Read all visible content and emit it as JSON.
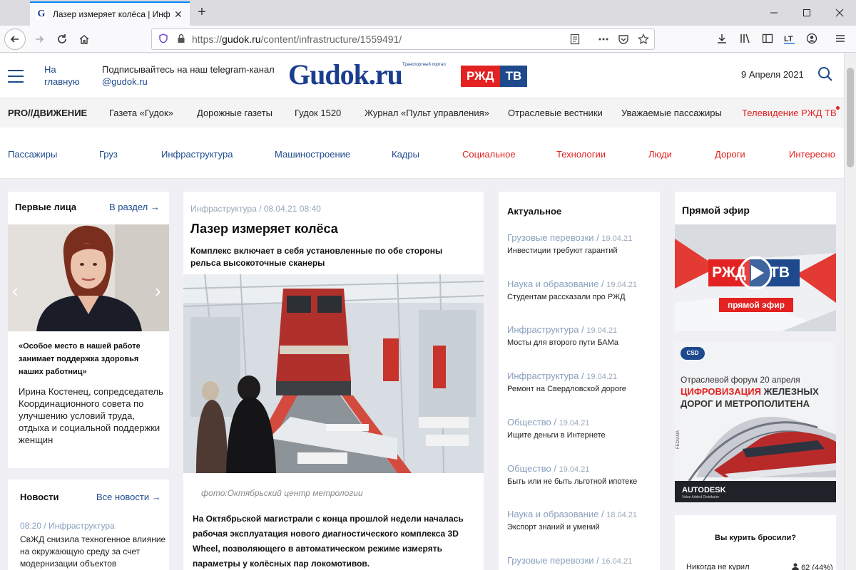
{
  "browser": {
    "tab_title": "Лазер измеряет колёса | Инфраструктура",
    "favicon_letter": "G",
    "tab_close": "✕",
    "new_tab": "+",
    "url_prefix": "https://",
    "url_host": "gudok.ru",
    "url_path": "/content/infrastructure/1559491/"
  },
  "header": {
    "home_link": "На главную",
    "telegram_text": "Подписывайтесь на наш telegram-канал",
    "telegram_handle": "@gudok.ru",
    "logo_text": "Gudok.ru",
    "logo_sub": "Транспортный портал",
    "rzd_left": "РЖД",
    "rzd_right": "ТВ",
    "date": "9 Апреля 2021"
  },
  "top_nav": [
    {
      "label": "PRO//ДВИЖЕНИЕ"
    },
    {
      "label": "Газета «Гудок»"
    },
    {
      "label": "Дорожные газеты"
    },
    {
      "label": "Гудок 1520"
    },
    {
      "label": "Журнал «Пульт управления»"
    },
    {
      "label": "Отраслевые вестники"
    },
    {
      "label": "Уважаемые пассажиры"
    },
    {
      "label": "Телевидение РЖД ТВ"
    }
  ],
  "categories": [
    {
      "label": "Пассажиры",
      "color": "#1e4a8d"
    },
    {
      "label": "Груз",
      "color": "#1e4a8d"
    },
    {
      "label": "Инфраструктура",
      "color": "#1e4a8d"
    },
    {
      "label": "Машиностроение",
      "color": "#1e4a8d"
    },
    {
      "label": "Кадры",
      "color": "#1e4a8d"
    },
    {
      "label": "Социальное",
      "color": "#e32221"
    },
    {
      "label": "Технологии",
      "color": "#e32221"
    },
    {
      "label": "Люди",
      "color": "#e32221"
    },
    {
      "label": "Дороги",
      "color": "#e32221"
    },
    {
      "label": "Интересно",
      "color": "#e32221"
    }
  ],
  "first_persons": {
    "heading": "Первые лица",
    "link": "В раздел →",
    "prev": "‹",
    "next": "›",
    "quote": "«Особое место в нашей работе занимает поддержка здоровья наших работниц»",
    "person": "Ирина Костенец, сопредседатель Координационного совета по улучшению условий труда, отдыха и социальной поддержки женщин"
  },
  "news": {
    "heading": "Новости",
    "link": "Все новости →",
    "meta": "08:20 / Инфраструктура",
    "text": "СвЖД снизила техногенное влияние на окружающую среду за счет модернизации объектов"
  },
  "article": {
    "meta": "Инфраструктура / 08.04.21 08:40",
    "title": "Лазер измеряет колёса",
    "lead": "Комплекс включает в себя установленные по обе стороны рельса высокоточные сканеры",
    "caption": "фото:Октябрьский центр метрологии",
    "body": "На Октябрьской магистрали с конца прошлой недели началась рабочая эксплуатация нового диагностического комплекса 3D Wheel, позволяющего в автоматическом режиме измерять параметры у колёсных пар локомотивов."
  },
  "actual": {
    "heading": "Актуальное",
    "items": [
      {
        "cat": "Грузовые перевозки /",
        "date": "19.04.21",
        "title": "Инвестиции требуют гарантий"
      },
      {
        "cat": "Наука и образование /",
        "date": "19.04.21",
        "title": "Студентам рассказали про РЖД"
      },
      {
        "cat": "Инфраструктура /",
        "date": "19.04.21",
        "title": "Мосты для второго пути БАМа"
      },
      {
        "cat": "Инфраструктура /",
        "date": "19.04.21",
        "title": "Ремонт на Свердловской дороге"
      },
      {
        "cat": "Общество /",
        "date": "19.04.21",
        "title": "Ищите деньги в Интернете"
      },
      {
        "cat": "Общество /",
        "date": "19.04.21",
        "title": "Быть или не быть льготной ипотеке"
      },
      {
        "cat": "Наука и образование /",
        "date": "18.04.21",
        "title": "Экспорт знаний и умений"
      },
      {
        "cat": "Грузовые перевозки /",
        "date": "16.04.21",
        "title": ""
      }
    ]
  },
  "live": {
    "heading": "Прямой эфир",
    "rzd_left": "РЖД",
    "rzd_right": "ТВ",
    "badge": "прямой эфир"
  },
  "ad": {
    "logo": "CSD",
    "line1": "Отраслевой форум 20 апреля",
    "line2_red": "ЦИФРОВИЗАЦИЯ",
    "line2_rest": " ЖЕЛЕЗНЫХ",
    "line3": "ДОРОГ И МЕТРОПОЛИТЕНА",
    "brand": "AUTODESK",
    "brand_sub": "Value Added Distributor",
    "side": "FEDIANA"
  },
  "poll": {
    "question": "Вы курить бросили?",
    "option": "Никогда не курил",
    "value": "62 (44%)"
  },
  "colors": {
    "brand_blue": "#1e4a8d",
    "brand_red": "#e32221"
  }
}
